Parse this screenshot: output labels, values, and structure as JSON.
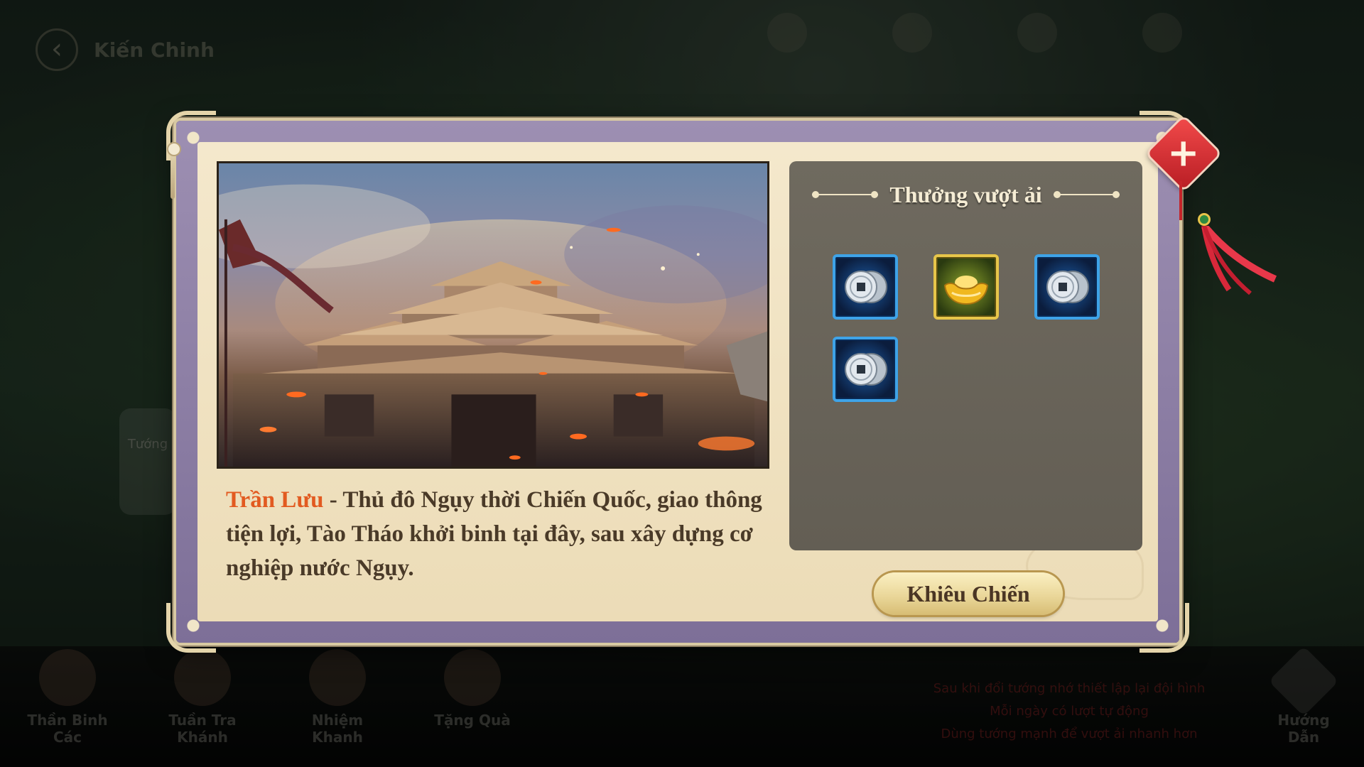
{
  "background": {
    "title": "Kiến Chinh",
    "side_button": "Tướng",
    "nav": [
      {
        "label": "Thần Binh Các"
      },
      {
        "label": "Tuần Tra Khánh"
      },
      {
        "label": "Nhiệm Khanh"
      },
      {
        "label": "Tặng Quà"
      }
    ],
    "right_nav_label": "Hướng Dẫn",
    "notice_lines": [
      "Sau khi đổi tướng nhớ thiết lập lại đội hình",
      "Mỗi ngày có lượt tự động",
      "Dùng tướng mạnh để vượt ải nhanh hơn"
    ]
  },
  "stage": {
    "name": "Trần Lưu",
    "description_rest": " - Thủ đô Ngụy thời Chiến Quốc, giao thông tiện lợi, Tào Tháo khởi binh tại đây, sau xây dựng cơ nghiệp nước Ngụy."
  },
  "rewards": {
    "title": "Thưởng vượt ải",
    "items": [
      {
        "icon": "silver-coin-icon",
        "frame": "blue"
      },
      {
        "icon": "gold-ingot-icon",
        "frame": "gold"
      },
      {
        "icon": "silver-coin-icon",
        "frame": "blue"
      },
      {
        "icon": "silver-coin-icon",
        "frame": "blue"
      }
    ]
  },
  "challenge_button_label": "Khiêu Chiến",
  "close_icon": "close-icon",
  "colors": {
    "accent_orange": "#e25a20",
    "panel_bg": "#6f6a5f",
    "frame_purple": "#8d7fa6",
    "parchment": "#f4e8cc"
  }
}
